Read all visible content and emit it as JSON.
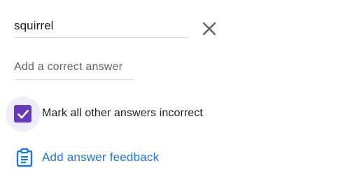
{
  "answer": {
    "value": "squirrel",
    "remove_icon": "close-icon"
  },
  "add_answer": {
    "placeholder": "Add a correct answer"
  },
  "mark_incorrect": {
    "checked": true,
    "label": "Mark all other answers incorrect",
    "checkbox_color": "#673ab7"
  },
  "feedback": {
    "icon": "clipboard-icon",
    "label": "Add answer feedback",
    "color": "#1a73e8"
  }
}
